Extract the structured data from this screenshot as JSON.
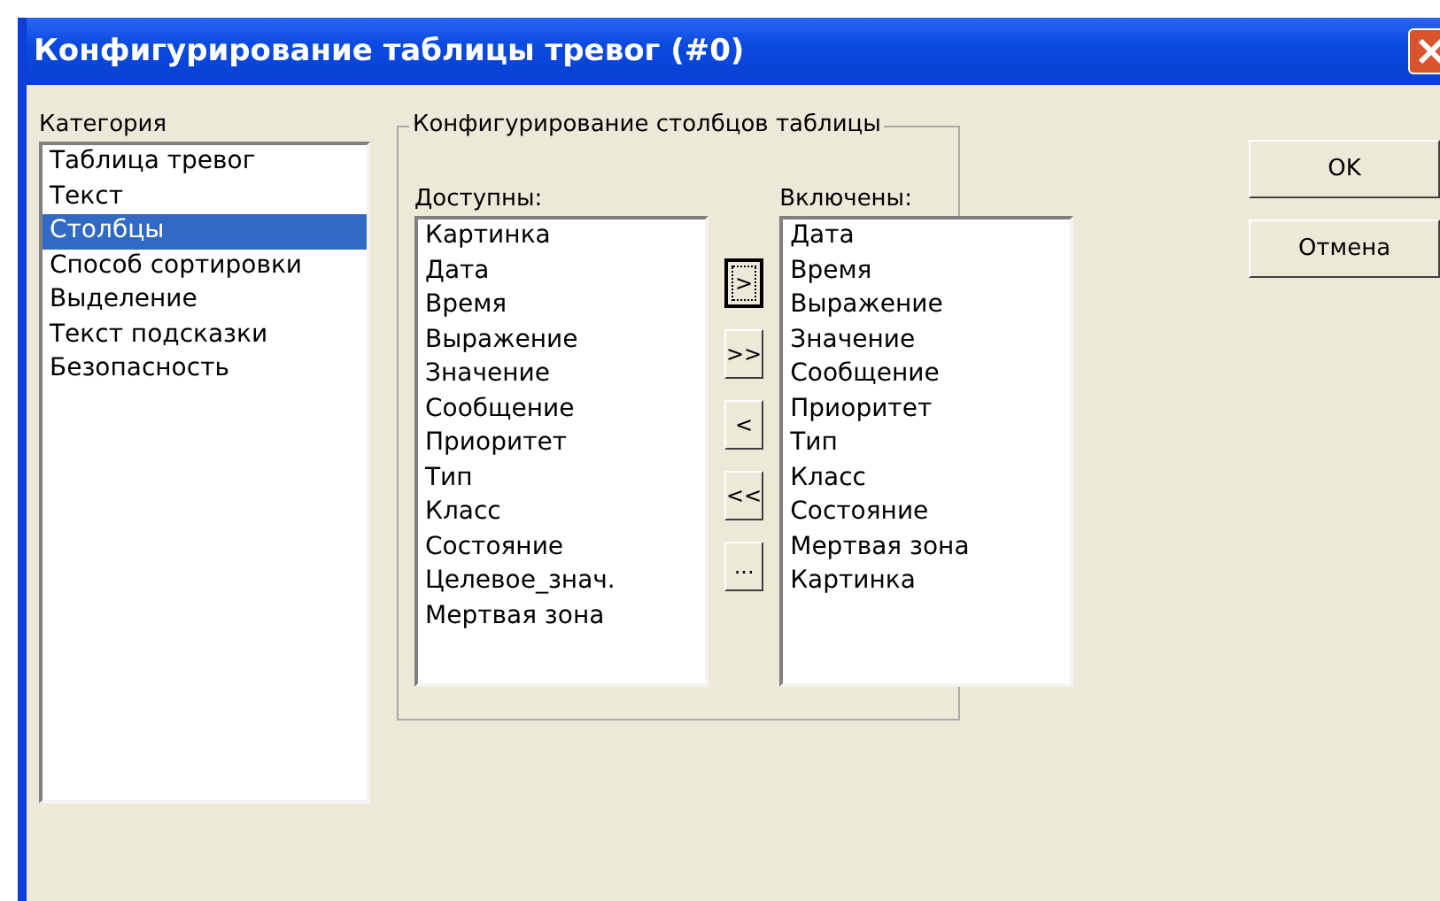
{
  "window": {
    "title": "Конфигурирование таблицы тревог (#0)"
  },
  "category": {
    "label": "Категория",
    "items": [
      {
        "label": "Таблица тревог",
        "selected": false
      },
      {
        "label": "Текст",
        "selected": false
      },
      {
        "label": "Столбцы",
        "selected": true
      },
      {
        "label": "Способ сортировки",
        "selected": false
      },
      {
        "label": "Выделение",
        "selected": false
      },
      {
        "label": "Текст подсказки",
        "selected": false
      },
      {
        "label": "Безопасность",
        "selected": false
      }
    ]
  },
  "group": {
    "title": "Конфигурирование столбцов таблицы",
    "available": {
      "label": "Доступны:",
      "items": [
        "Картинка",
        "Дата",
        "Время",
        "Выражение",
        "Значение",
        "Сообщение",
        "Приоритет",
        "Тип",
        "Класс",
        "Состояние",
        "Целевое_знач.",
        "Мертвая зона"
      ]
    },
    "move_buttons": [
      {
        "label": ">",
        "focused": true
      },
      {
        "label": ">>",
        "focused": false
      },
      {
        "label": "<",
        "focused": false
      },
      {
        "label": "<<",
        "focused": false
      },
      {
        "label": "...",
        "focused": false
      }
    ],
    "included": {
      "label": "Включены:",
      "items": [
        "Дата",
        "Время",
        "Выражение",
        "Значение",
        "Сообщение",
        "Приоритет",
        "Тип",
        "Класс",
        "Состояние",
        "Мертвая зона",
        "Картинка"
      ]
    }
  },
  "buttons": [
    "OK",
    "Отмена"
  ]
}
